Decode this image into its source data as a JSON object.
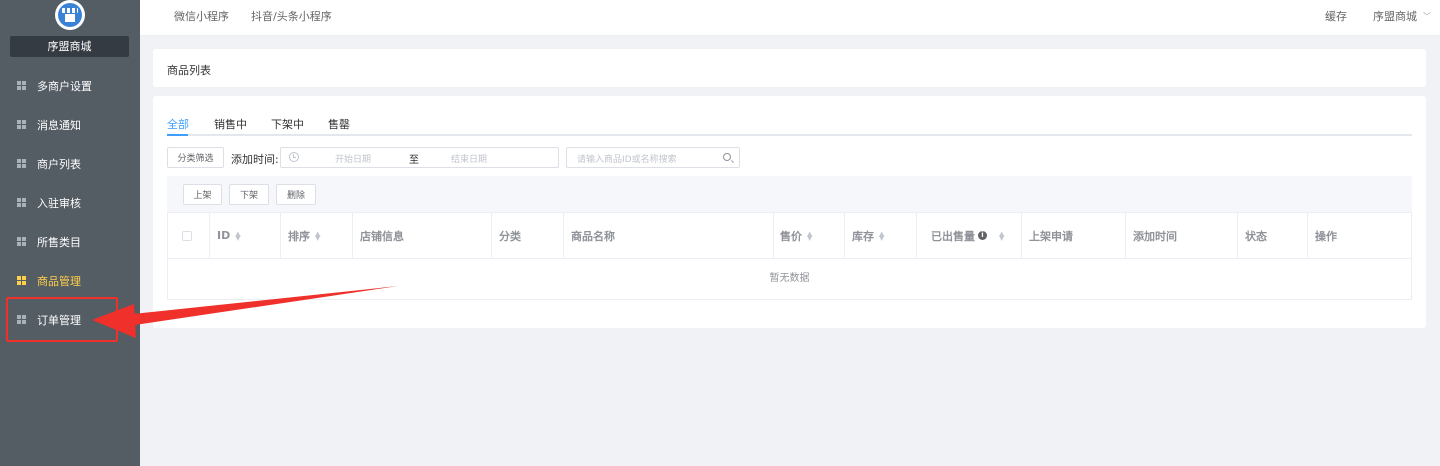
{
  "sidebar": {
    "shop_name": "序盟商城",
    "items": [
      {
        "label": "多商户设置"
      },
      {
        "label": "消息通知"
      },
      {
        "label": "商户列表"
      },
      {
        "label": "入驻审核"
      },
      {
        "label": "所售类目"
      },
      {
        "label": "商品管理"
      },
      {
        "label": "订单管理"
      }
    ],
    "active_index": 5
  },
  "header": {
    "tabs": [
      {
        "label": "微信小程序"
      },
      {
        "label": "抖音/头条小程序"
      }
    ],
    "cache_label": "缓存",
    "user_menu": "序盟商城"
  },
  "page": {
    "title": "商品列表",
    "status_tabs": [
      {
        "label": "全部"
      },
      {
        "label": "销售中"
      },
      {
        "label": "下架中"
      },
      {
        "label": "售罄"
      }
    ],
    "active_tab": 0,
    "filter": {
      "category_button": "分类筛选",
      "date_label": "添加时间:",
      "start_placeholder": "开始日期",
      "range_separator": "至",
      "end_placeholder": "结束日期",
      "search_placeholder": "请输入商品ID或名称搜索"
    },
    "bulk_actions": {
      "on_shelf": "上架",
      "off_shelf": "下架",
      "delete": "删除"
    },
    "table": {
      "columns": [
        "ID",
        "排序",
        "店铺信息",
        "分类",
        "商品名称",
        "售价",
        "库存",
        "已出售量",
        "上架申请",
        "添加时间",
        "状态",
        "操作"
      ],
      "empty_text": "暂无数据"
    }
  },
  "colors": {
    "sidebar_bg": "#545c64",
    "active": "#ffd04b",
    "primary": "#409eff",
    "annotation": "#f0302a"
  }
}
